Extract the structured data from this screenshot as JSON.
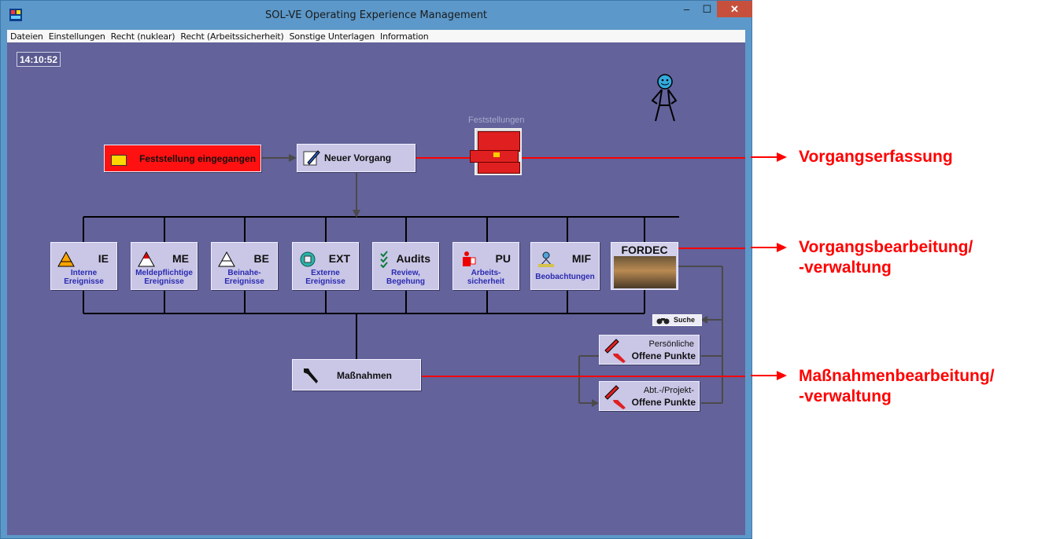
{
  "window": {
    "title": "SOL-VE Operating Experience Management",
    "controls": {
      "minimize": "–",
      "maximize": "☐",
      "close": "✕"
    }
  },
  "menu": [
    "Dateien",
    "Einstellungen",
    "Recht (nuklear)",
    "Recht (Arbeitssicherheit)",
    "Sonstige Unterlagen",
    "Information"
  ],
  "clock": "14:10:52",
  "flow": {
    "incoming": "Feststellung eingegangen",
    "new_case": "Neuer Vorgang",
    "findings_label": "Feststellungen",
    "categories": [
      {
        "code": "IE",
        "sub1": "Interne",
        "sub2": "Ereignisse",
        "icon": "warning-triangle-orange-icon"
      },
      {
        "code": "ME",
        "sub1": "Meldepflichtige",
        "sub2": "Ereignisse",
        "icon": "warning-triangle-red-icon"
      },
      {
        "code": "BE",
        "sub1": "Beinahe-",
        "sub2": "Ereignisse",
        "icon": "warning-triangle-outline-icon"
      },
      {
        "code": "EXT",
        "sub1": "Externe",
        "sub2": "Ereignisse",
        "icon": "external-event-icon"
      },
      {
        "code": "Audits",
        "sub1": "Review,",
        "sub2": "Begehung",
        "icon": "checklist-icon"
      },
      {
        "code": "PU",
        "sub1": "Arbeits-",
        "sub2": "sicherheit",
        "icon": "worker-safety-icon"
      },
      {
        "code": "MIF",
        "sub1": "Beobachtungen",
        "sub2": "",
        "icon": "observer-icon"
      }
    ],
    "fordec": "FORDEC",
    "search": "Suche",
    "measures": "Maßnahmen",
    "open_points": [
      {
        "line1": "Persönliche",
        "line2": "Offene Punkte"
      },
      {
        "line1": "Abt.-/Projekt-",
        "line2": "Offene Punkte"
      }
    ]
  },
  "annotations": {
    "capture": "Vorgangserfassung",
    "processing": [
      "Vorgangsbearbeitung/",
      "-verwaltung"
    ],
    "measures": [
      "Maßnahmenbearbeitung/",
      "-verwaltung"
    ]
  },
  "colors": {
    "canvas": "#63629a",
    "box": "#c9c6e6",
    "accent_red": "#ff0000",
    "subtext_blue": "#2a2ab0"
  }
}
